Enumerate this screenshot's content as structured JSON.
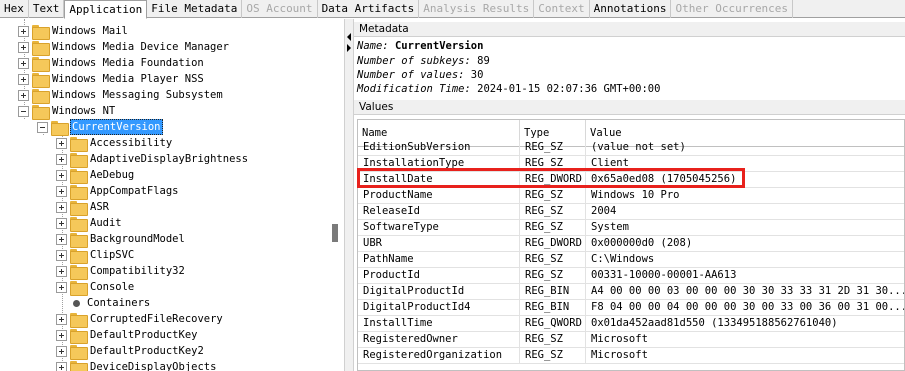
{
  "tabs": [
    {
      "label": "Hex",
      "state": "normal"
    },
    {
      "label": "Text",
      "state": "normal"
    },
    {
      "label": "Application",
      "state": "active"
    },
    {
      "label": "File Metadata",
      "state": "normal"
    },
    {
      "label": "OS Account",
      "state": "disabled"
    },
    {
      "label": "Data Artifacts",
      "state": "normal"
    },
    {
      "label": "Analysis Results",
      "state": "disabled"
    },
    {
      "label": "Context",
      "state": "disabled"
    },
    {
      "label": "Annotations",
      "state": "normal"
    },
    {
      "label": "Other Occurrences",
      "state": "disabled"
    }
  ],
  "tree": {
    "parent_items": [
      {
        "label": "Windows Mail"
      },
      {
        "label": "Windows Media Device Manager"
      },
      {
        "label": "Windows Media Foundation"
      },
      {
        "label": "Windows Media Player NSS"
      },
      {
        "label": "Windows Messaging Subsystem"
      },
      {
        "label": "Windows NT"
      }
    ],
    "selected": {
      "label": "CurrentVersion"
    },
    "children": [
      {
        "label": "Accessibility",
        "type": "folder"
      },
      {
        "label": "AdaptiveDisplayBrightness",
        "type": "folder"
      },
      {
        "label": "AeDebug",
        "type": "folder"
      },
      {
        "label": "AppCompatFlags",
        "type": "folder"
      },
      {
        "label": "ASR",
        "type": "folder"
      },
      {
        "label": "Audit",
        "type": "folder"
      },
      {
        "label": "BackgroundModel",
        "type": "folder"
      },
      {
        "label": "ClipSVC",
        "type": "folder"
      },
      {
        "label": "Compatibility32",
        "type": "folder"
      },
      {
        "label": "Console",
        "type": "folder"
      },
      {
        "label": "Containers",
        "type": "leaf"
      },
      {
        "label": "CorruptedFileRecovery",
        "type": "folder"
      },
      {
        "label": "DefaultProductKey",
        "type": "folder"
      },
      {
        "label": "DefaultProductKey2",
        "type": "folder"
      },
      {
        "label": "DeviceDisplayObjects",
        "type": "folder"
      }
    ]
  },
  "metadata": {
    "header": "Metadata",
    "name_key": "Name:",
    "name_value": "CurrentVersion",
    "subkeys_key": "Number of subkeys:",
    "subkeys_value": "89",
    "values_key": "Number of values:",
    "values_value": "30",
    "modified_key": "Modification Time:",
    "modified_value": "2024-01-15 02:07:36 GMT+00:00"
  },
  "values": {
    "header": "Values",
    "columns": {
      "name": "Name",
      "type": "Type",
      "value": "Value"
    },
    "rows": [
      {
        "name": "EditionSubVersion",
        "type": "REG_SZ",
        "value": "(value not set)"
      },
      {
        "name": "InstallationType",
        "type": "REG_SZ",
        "value": "Client"
      },
      {
        "name": "InstallDate",
        "type": "REG_DWORD",
        "value": "0x65a0ed08 (1705045256)"
      },
      {
        "name": "ProductName",
        "type": "REG_SZ",
        "value": "Windows 10 Pro"
      },
      {
        "name": "ReleaseId",
        "type": "REG_SZ",
        "value": "2004"
      },
      {
        "name": "SoftwareType",
        "type": "REG_SZ",
        "value": "System"
      },
      {
        "name": "UBR",
        "type": "REG_DWORD",
        "value": "0x000000d0 (208)"
      },
      {
        "name": "PathName",
        "type": "REG_SZ",
        "value": "C:\\Windows"
      },
      {
        "name": "ProductId",
        "type": "REG_SZ",
        "value": "00331-10000-00001-AA613"
      },
      {
        "name": "DigitalProductId",
        "type": "REG_BIN",
        "value": "A4 00 00 00 03 00 00 00 30 30 33 33 31 2D 31 30..."
      },
      {
        "name": "DigitalProductId4",
        "type": "REG_BIN",
        "value": "F8 04 00 00 04 00 00 00 30 00 33 00 36 00 31 00..."
      },
      {
        "name": "InstallTime",
        "type": "REG_QWORD",
        "value": "0x01da452aad81d550 (133495188562761040)"
      },
      {
        "name": "RegisteredOwner",
        "type": "REG_SZ",
        "value": "Microsoft"
      },
      {
        "name": "RegisteredOrganization",
        "type": "REG_SZ",
        "value": "Microsoft"
      }
    ]
  },
  "highlight_color": "#e8211c",
  "selection_color": "#3399ff"
}
